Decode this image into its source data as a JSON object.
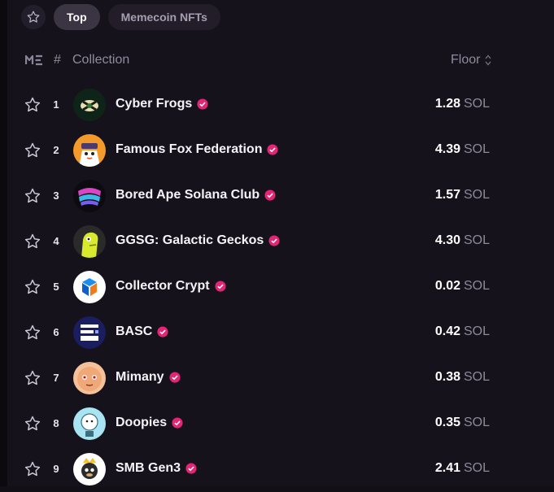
{
  "tabs": {
    "favorites_icon": "star-icon",
    "items": [
      {
        "label": "Top",
        "active": true
      },
      {
        "label": "Memecoin NFTs",
        "active": false
      }
    ]
  },
  "header": {
    "logo": "magic-eden-logo",
    "rank": "#",
    "collection": "Collection",
    "floor": "Floor"
  },
  "accent_color": "#e42575",
  "collections": [
    {
      "rank": "1",
      "name": "Cyber Frogs",
      "floor": "1.28",
      "unit": "SOL"
    },
    {
      "rank": "2",
      "name": "Famous Fox Federation",
      "floor": "4.39",
      "unit": "SOL"
    },
    {
      "rank": "3",
      "name": "Bored Ape Solana Club",
      "floor": "1.57",
      "unit": "SOL"
    },
    {
      "rank": "4",
      "name": "GGSG: Galactic Geckos",
      "floor": "4.30",
      "unit": "SOL"
    },
    {
      "rank": "5",
      "name": "Collector Crypt",
      "floor": "0.02",
      "unit": "SOL"
    },
    {
      "rank": "6",
      "name": "BASC",
      "floor": "0.42",
      "unit": "SOL"
    },
    {
      "rank": "7",
      "name": "Mimany",
      "floor": "0.38",
      "unit": "SOL"
    },
    {
      "rank": "8",
      "name": "Doopies",
      "floor": "0.35",
      "unit": "SOL"
    },
    {
      "rank": "9",
      "name": "SMB Gen3",
      "floor": "2.41",
      "unit": "SOL"
    }
  ]
}
